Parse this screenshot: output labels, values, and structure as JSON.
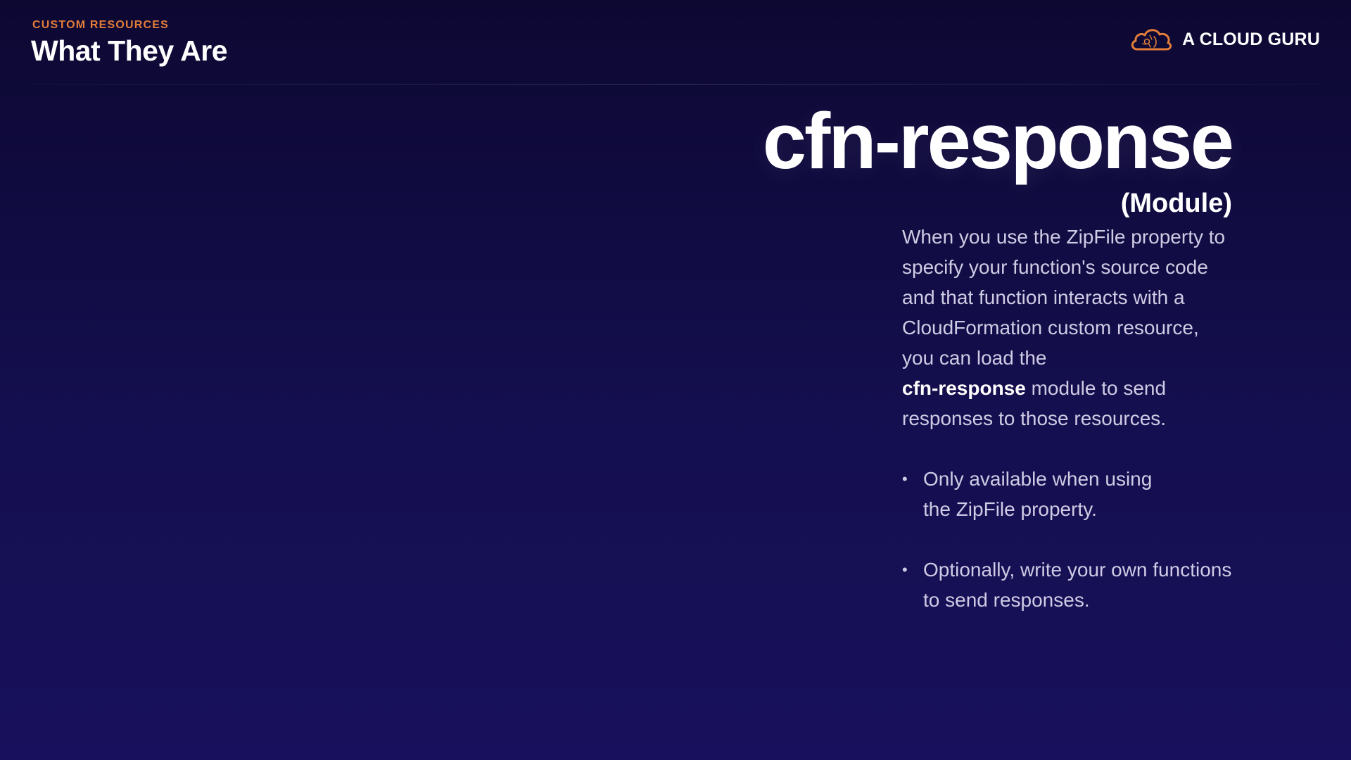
{
  "header": {
    "eyebrow": "CUSTOM RESOURCES",
    "title": "What They Are"
  },
  "brand": {
    "name": "A CLOUD GURU",
    "icon": "cloud-logo-icon",
    "accent_color": "#e37d3a"
  },
  "hero": {
    "title": "cfn-response",
    "subtitle": "(Module)"
  },
  "body": {
    "intro": "When you use the ZipFile property to\nspecify your function's source code\nand that function interacts with a\nCloudFormation custom resource,\nyou can load the",
    "emphasis": "cfn-response",
    "outro": " module to send\nresponses to those resources."
  },
  "bullets": [
    {
      "text": "Only available when using\nthe ZipFile property."
    },
    {
      "text": "Optionally, write your own functions\nto send responses."
    }
  ],
  "colors": {
    "background_top": "#0d0832",
    "background_bottom": "#18105c",
    "eyebrow": "#e37d3a",
    "body_text": "#cfcbe4"
  }
}
